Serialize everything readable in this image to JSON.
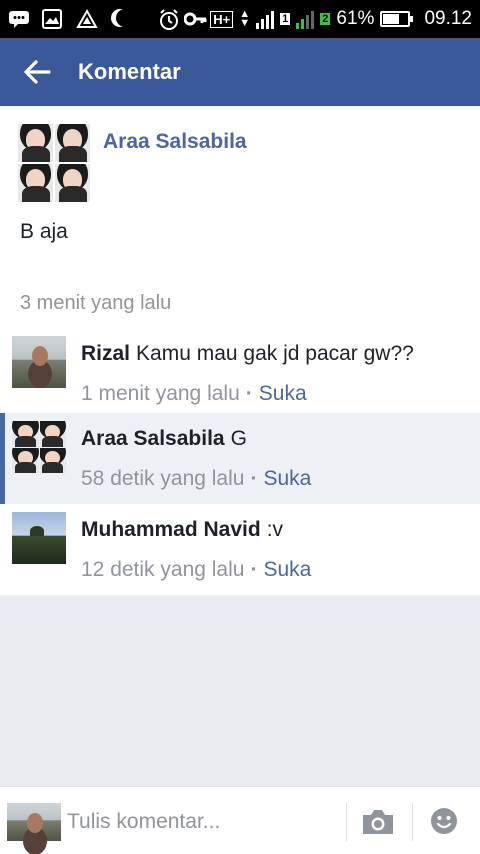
{
  "status_bar": {
    "battery": "61%",
    "time": "09.12",
    "network": "H+",
    "sim1": "1",
    "sim2": "2"
  },
  "header": {
    "title": "Komentar"
  },
  "post": {
    "author": "Araa Salsabila",
    "text": "B aja",
    "time": "3 menit yang lalu"
  },
  "comments": [
    {
      "name": "Rizal",
      "text": "Kamu mau gak jd pacar gw??",
      "time": "1 menit yang lalu",
      "like": "Suka"
    },
    {
      "name": "Araa Salsabila",
      "text": "G",
      "time": "58 detik yang lalu",
      "like": "Suka"
    },
    {
      "name": "Muhammad Navid",
      "text": ":v",
      "time": "12 detik yang lalu",
      "like": "Suka"
    }
  ],
  "composer": {
    "placeholder": "Tulis komentar..."
  },
  "colors": {
    "header": "#3b5998",
    "link": "#4b67a1",
    "meta": "#90949c",
    "background": "#e9ebee"
  }
}
